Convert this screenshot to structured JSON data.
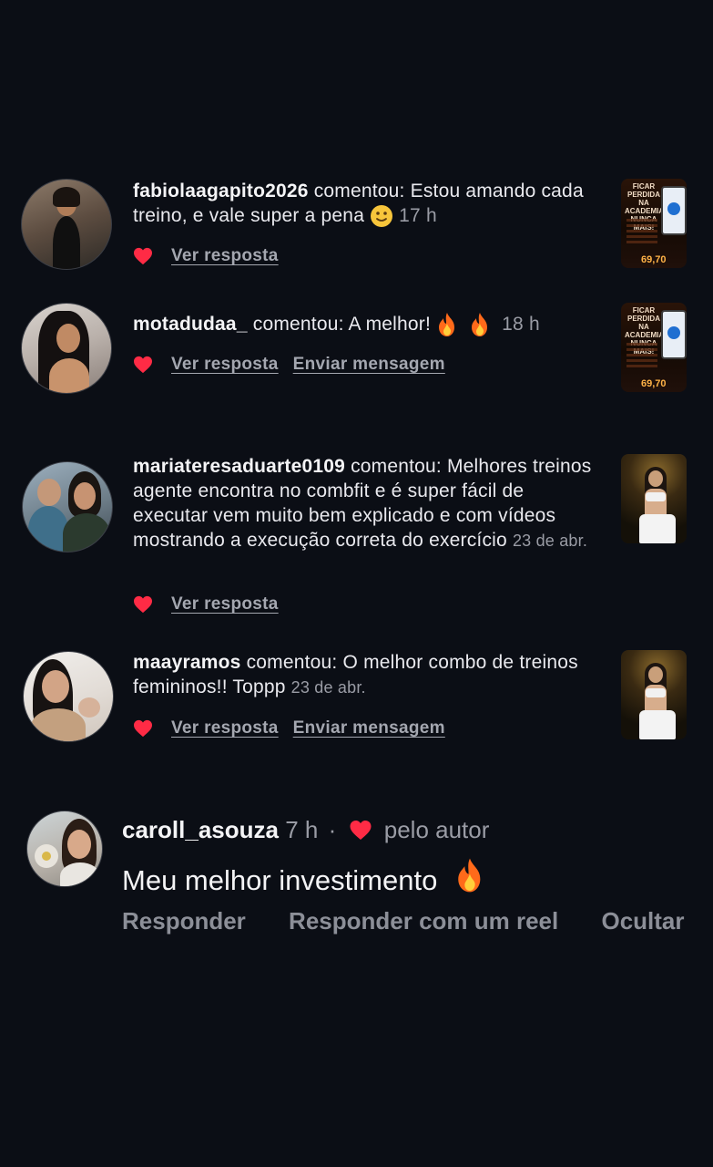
{
  "notifications": [
    {
      "username": "fabiolaagapito2026",
      "verb": "comentou:",
      "message": "Estou amando cada treino, e vale super a pena",
      "emoji": "smile-emoji",
      "time": "17 h",
      "actions": [
        "Ver resposta"
      ],
      "liked": true,
      "thumbnail": "ad-flyer"
    },
    {
      "username": "motadudaa_",
      "verb": "comentou:",
      "message": "A melhor!",
      "emoji": "fire-emoji-x2",
      "time": "18 h",
      "actions": [
        "Ver resposta",
        "Enviar mensagem"
      ],
      "liked": true,
      "thumbnail": "ad-flyer"
    },
    {
      "username": "mariateresaduarte0109",
      "verb": "comentou:",
      "message": "Melhores treinos agente encontra no combfit e é super fácil de executar vem muito bem explicado e com vídeos mostrando a execução correta do exercício",
      "time": "23 de abr.",
      "actions": [
        "Ver resposta"
      ],
      "liked": true,
      "thumbnail": "fitness-photo"
    },
    {
      "username": "maayramos",
      "verb": "comentou:",
      "message": "O melhor combo de treinos femininos!! Toppp",
      "time": "23 de abr.",
      "actions": [
        "Ver resposta",
        "Enviar mensagem"
      ],
      "liked": true,
      "thumbnail": "fitness-photo"
    }
  ],
  "ad": {
    "title": "FICAR PERDIDA NA ACADEMIA NUNCA MAIS!",
    "price": "69,70"
  },
  "comment": {
    "username": "caroll_asouza",
    "time": "7 h",
    "separator": "·",
    "liked_by": "pelo autor",
    "text": "Meu melhor investimento",
    "actions": [
      "Responder",
      "Responder com um reel",
      "Ocultar"
    ]
  },
  "colors": {
    "background": "#0b0e15",
    "heart": "#ff2b45",
    "muted": "#9a9ca5"
  }
}
